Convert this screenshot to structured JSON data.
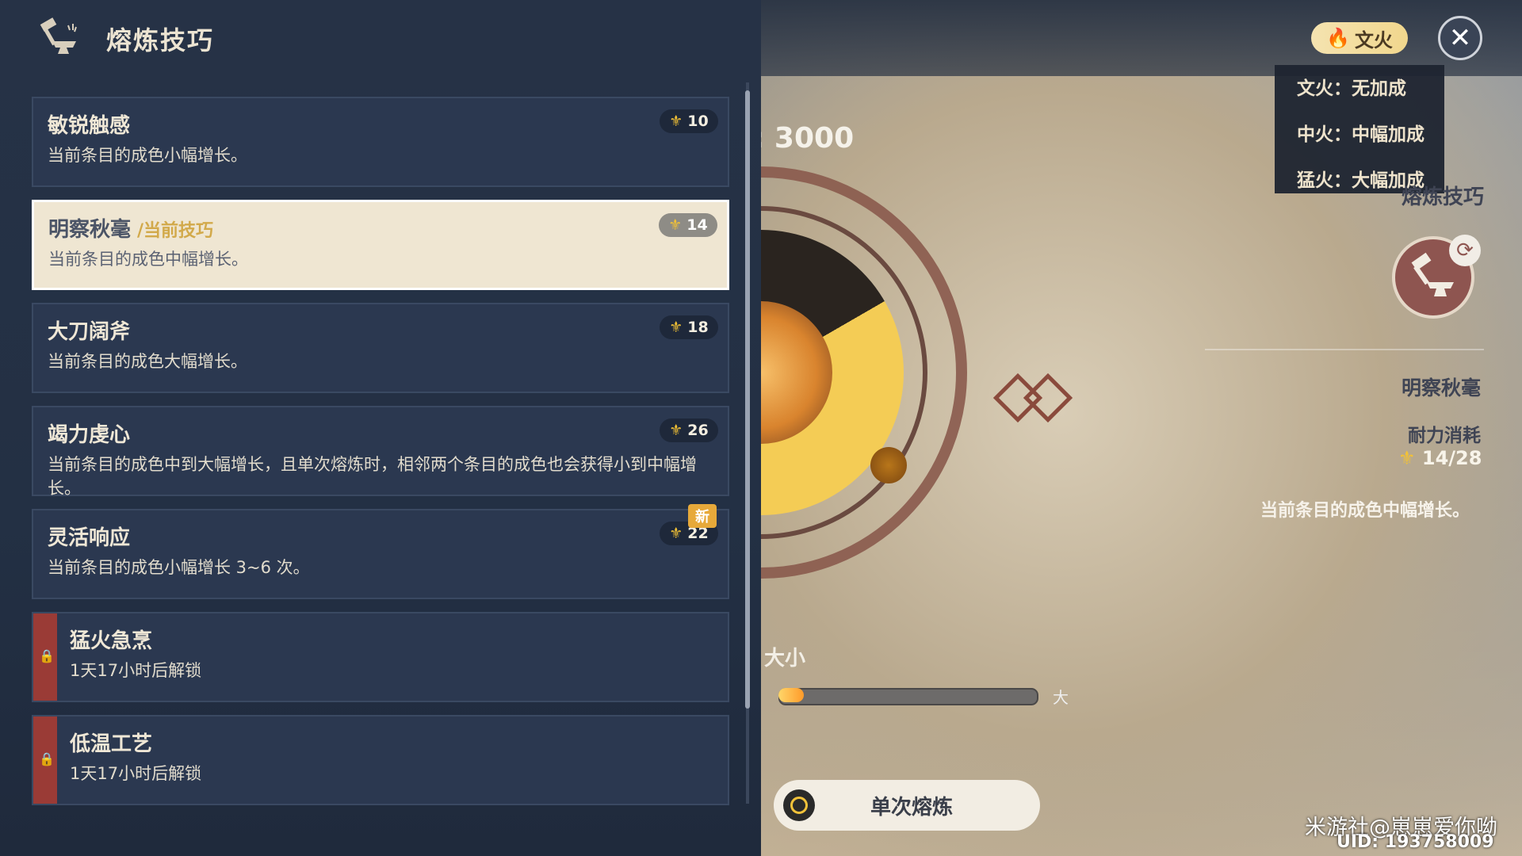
{
  "header": {
    "title": "熔炼技巧"
  },
  "skills": [
    {
      "name": "敏锐触感",
      "tag": "",
      "desc": "当前条目的成色小幅增长。",
      "cost": "10",
      "state": "normal",
      "new": ""
    },
    {
      "name": "明察秋毫",
      "tag": "/当前技巧",
      "desc": "当前条目的成色中幅增长。",
      "cost": "14",
      "state": "selected",
      "new": ""
    },
    {
      "name": "大刀阔斧",
      "tag": "",
      "desc": "当前条目的成色大幅增长。",
      "cost": "18",
      "state": "normal",
      "new": ""
    },
    {
      "name": "竭力虔心",
      "tag": "",
      "desc": "当前条目的成色中到大幅增长，且单次熔炼时，相邻两个条目的成色也会获得小到中幅增长。",
      "cost": "26",
      "state": "normal",
      "new": ""
    },
    {
      "name": "灵活响应",
      "tag": "",
      "desc": "当前条目的成色小幅增长 3~6 次。",
      "cost": "22",
      "state": "normal",
      "new": "新"
    },
    {
      "name": "猛火急烹",
      "tag": "",
      "desc": "1天17小时后解锁",
      "cost": "",
      "state": "locked",
      "new": ""
    },
    {
      "name": "低温工艺",
      "tag": "",
      "desc": "1天17小时后解锁",
      "cost": "",
      "state": "locked",
      "new": ""
    }
  ],
  "fire": {
    "current": "文火",
    "options": [
      "文火：无加成",
      "中火：中幅加成",
      "猛火：大幅加成"
    ]
  },
  "score": {
    "text": ": 3000"
  },
  "heat": {
    "label": "大小",
    "end_label": "大",
    "fill_fraction": 0.1
  },
  "info": {
    "section_title": "熔炼技巧",
    "skill_name": "明察秋毫",
    "stamina_label": "耐力消耗",
    "stamina_value": "14/28",
    "desc": "当前条目的成色中幅增长。"
  },
  "actions": {
    "smelt_once": "单次熔炼"
  },
  "watermark": {
    "text": "米游社@崽崽爱你呦",
    "uid": "UID: 193758009"
  },
  "icons": {
    "header": "anvil-hammer-icon",
    "cost": "stamina-icon",
    "lock": "lock-icon",
    "fire": "flame-icon",
    "close": "close-icon",
    "refresh": "refresh-icon"
  }
}
